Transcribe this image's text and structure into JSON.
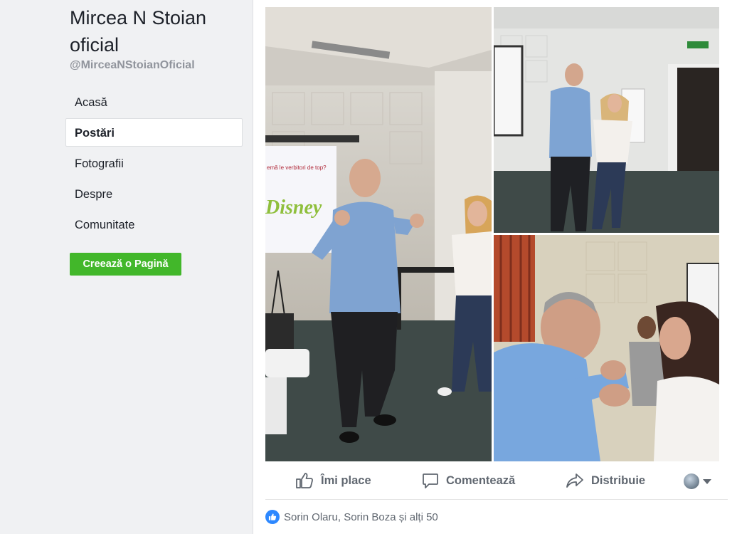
{
  "page": {
    "name": "Mircea N Stoian oficial",
    "handle": "@MirceaNStoianOficial"
  },
  "nav": [
    {
      "label": "Acasă",
      "active": false
    },
    {
      "label": "Postări",
      "active": true
    },
    {
      "label": "Fotografii",
      "active": false
    },
    {
      "label": "Despre",
      "active": false
    },
    {
      "label": "Comunitate",
      "active": false
    }
  ],
  "create_page_button": "Creează o Pagină",
  "post": {
    "photos": [
      {
        "name": "photo-main",
        "screen_text": "emă le verbitori de top?",
        "logo": "Disney"
      },
      {
        "name": "photo-top-right"
      },
      {
        "name": "photo-bottom-right"
      }
    ],
    "actions": {
      "like": "Îmi place",
      "comment": "Comentează",
      "share": "Distribuie"
    },
    "reactions_text": "Sorin Olaru, Sorin Boza și alți 50"
  },
  "colors": {
    "accent_green": "#42b72a",
    "like_blue": "#2d88ff",
    "text_secondary": "#606770"
  }
}
